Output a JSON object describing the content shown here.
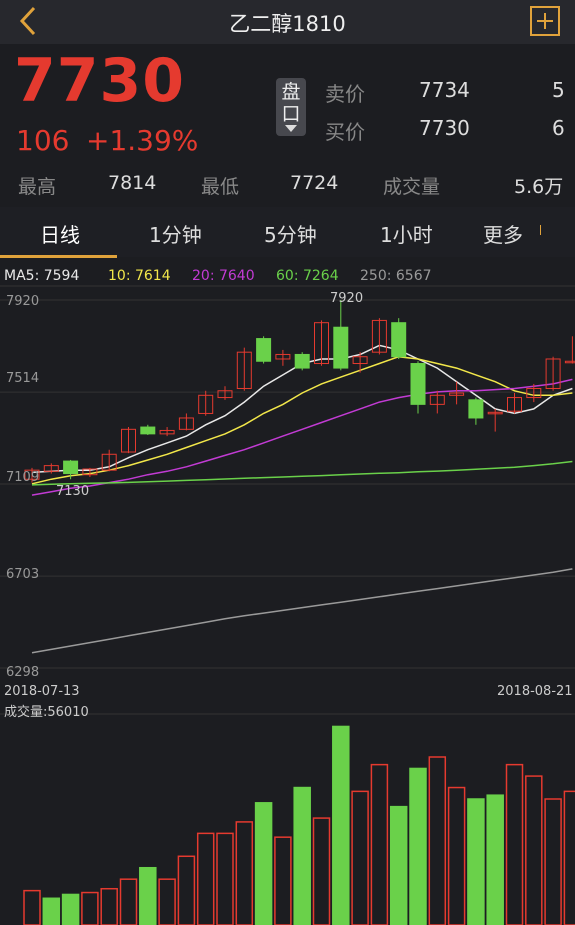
{
  "header": {
    "title": "乙二醇1810"
  },
  "quote": {
    "price": "7730",
    "change": "106",
    "change_pct": "+1.39%"
  },
  "panel_button": {
    "label": "盘口"
  },
  "orderbook": {
    "sell_label": "卖价",
    "sell_price": "7734",
    "sell_vol": "5",
    "buy_label": "买价",
    "buy_price": "7730",
    "buy_vol": "6"
  },
  "stats": {
    "high_label": "最高",
    "high": "7814",
    "low_label": "最低",
    "low": "7724",
    "vol_label": "成交量",
    "vol": "5.6万"
  },
  "tabs": [
    "日线",
    "1分钟",
    "5分钟",
    "1小时",
    "更多"
  ],
  "ma_legend": [
    {
      "text": "MA5: 7594",
      "color": "#e8e8e8"
    },
    {
      "text": "10: 7614",
      "color": "#f2e74a"
    },
    {
      "text": "20: 7640",
      "color": "#c23bd4"
    },
    {
      "text": "60: 7264",
      "color": "#6ad14a"
    },
    {
      "text": "250: 6567",
      "color": "#9a9a9a"
    }
  ],
  "chart_data": [
    {
      "type": "candlestick",
      "y_ticks": [
        "7920",
        "7514",
        "7109",
        "6703",
        "6298"
      ],
      "x_tick_start": "2018-07-13",
      "x_tick_end": "2018-08-21",
      "ylim": [
        6298,
        7920
      ],
      "annotations": [
        {
          "text": "7920",
          "value": 7920
        },
        {
          "text": "7130",
          "value": 7130
        }
      ],
      "candles": [
        {
          "o": 7130,
          "c": 7170,
          "h": 7180,
          "l": 7115
        },
        {
          "o": 7165,
          "c": 7190,
          "h": 7200,
          "l": 7155
        },
        {
          "o": 7210,
          "c": 7155,
          "h": 7215,
          "l": 7130
        },
        {
          "o": 7150,
          "c": 7175,
          "h": 7180,
          "l": 7140
        },
        {
          "o": 7170,
          "c": 7240,
          "h": 7260,
          "l": 7165
        },
        {
          "o": 7250,
          "c": 7350,
          "h": 7360,
          "l": 7245
        },
        {
          "o": 7360,
          "c": 7330,
          "h": 7370,
          "l": 7325
        },
        {
          "o": 7330,
          "c": 7345,
          "h": 7360,
          "l": 7320
        },
        {
          "o": 7350,
          "c": 7400,
          "h": 7420,
          "l": 7345
        },
        {
          "o": 7420,
          "c": 7500,
          "h": 7520,
          "l": 7410
        },
        {
          "o": 7490,
          "c": 7520,
          "h": 7540,
          "l": 7480
        },
        {
          "o": 7530,
          "c": 7690,
          "h": 7710,
          "l": 7520
        },
        {
          "o": 7750,
          "c": 7650,
          "h": 7760,
          "l": 7640
        },
        {
          "o": 7660,
          "c": 7680,
          "h": 7700,
          "l": 7630
        },
        {
          "o": 7680,
          "c": 7620,
          "h": 7690,
          "l": 7610
        },
        {
          "o": 7640,
          "c": 7820,
          "h": 7830,
          "l": 7630
        },
        {
          "o": 7800,
          "c": 7620,
          "h": 7920,
          "l": 7610
        },
        {
          "o": 7640,
          "c": 7670,
          "h": 7690,
          "l": 7600
        },
        {
          "o": 7690,
          "c": 7830,
          "h": 7840,
          "l": 7680
        },
        {
          "o": 7820,
          "c": 7670,
          "h": 7840,
          "l": 7660
        },
        {
          "o": 7640,
          "c": 7460,
          "h": 7650,
          "l": 7420
        },
        {
          "o": 7460,
          "c": 7500,
          "h": 7520,
          "l": 7420
        },
        {
          "o": 7500,
          "c": 7510,
          "h": 7560,
          "l": 7460
        },
        {
          "o": 7480,
          "c": 7400,
          "h": 7490,
          "l": 7370
        },
        {
          "o": 7420,
          "c": 7425,
          "h": 7440,
          "l": 7340
        },
        {
          "o": 7430,
          "c": 7490,
          "h": 7510,
          "l": 7420
        },
        {
          "o": 7490,
          "c": 7530,
          "h": 7550,
          "l": 7470
        },
        {
          "o": 7530,
          "c": 7660,
          "h": 7670,
          "l": 7520
        },
        {
          "o": 7650,
          "c": 7650,
          "h": 7760,
          "l": 7640
        }
      ],
      "ma_lines": [
        {
          "name": "MA5",
          "color": "#e8e8e8",
          "values": [
            7160,
            7165,
            7170,
            7170,
            7185,
            7225,
            7260,
            7290,
            7320,
            7370,
            7410,
            7470,
            7540,
            7590,
            7640,
            7660,
            7660,
            7680,
            7720,
            7700,
            7660,
            7620,
            7560,
            7500,
            7440,
            7420,
            7440,
            7500,
            7530
          ]
        },
        {
          "name": "MA10",
          "color": "#f2e74a",
          "values": [
            7110,
            7130,
            7145,
            7155,
            7170,
            7190,
            7215,
            7240,
            7270,
            7300,
            7330,
            7370,
            7420,
            7460,
            7510,
            7550,
            7580,
            7610,
            7640,
            7670,
            7660,
            7640,
            7620,
            7590,
            7560,
            7520,
            7500,
            7500,
            7510
          ]
        },
        {
          "name": "MA20",
          "color": "#c23bd4",
          "values": [
            7060,
            7075,
            7090,
            7100,
            7115,
            7130,
            7150,
            7165,
            7185,
            7210,
            7235,
            7260,
            7290,
            7320,
            7350,
            7380,
            7410,
            7440,
            7470,
            7490,
            7505,
            7515,
            7520,
            7520,
            7525,
            7530,
            7540,
            7550,
            7570
          ]
        },
        {
          "name": "MA60",
          "color": "#6ad14a",
          "values": [
            7105,
            7108,
            7110,
            7112,
            7114,
            7116,
            7119,
            7122,
            7125,
            7128,
            7131,
            7134,
            7137,
            7140,
            7143,
            7146,
            7150,
            7153,
            7156,
            7159,
            7163,
            7166,
            7170,
            7174,
            7178,
            7183,
            7190,
            7198,
            7208
          ]
        },
        {
          "name": "MA250",
          "color": "#9a9a9a",
          "values": [
            6365,
            6380,
            6395,
            6410,
            6425,
            6440,
            6455,
            6470,
            6485,
            6500,
            6515,
            6528,
            6540,
            6552,
            6564,
            6576,
            6588,
            6600,
            6612,
            6624,
            6636,
            6648,
            6660,
            6672,
            6684,
            6696,
            6708,
            6720,
            6735
          ]
        }
      ]
    },
    {
      "type": "bar",
      "title": "成交量:56010",
      "values": [
        18000,
        14000,
        16000,
        17000,
        19000,
        24000,
        30000,
        24000,
        36000,
        48000,
        48000,
        54000,
        64000,
        46000,
        72000,
        56000,
        104000,
        70000,
        84000,
        62000,
        82000,
        88000,
        72000,
        66000,
        68000,
        84000,
        78000,
        66000,
        70000,
        42000
      ],
      "colors": [
        "#e53a2f",
        "#6ad14a",
        "#6ad14a",
        "#e53a2f",
        "#e53a2f",
        "#e53a2f",
        "#6ad14a",
        "#e53a2f",
        "#e53a2f",
        "#e53a2f",
        "#e53a2f",
        "#e53a2f",
        "#6ad14a",
        "#e53a2f",
        "#6ad14a",
        "#e53a2f",
        "#6ad14a",
        "#e53a2f",
        "#e53a2f",
        "#6ad14a",
        "#6ad14a",
        "#e53a2f",
        "#e53a2f",
        "#6ad14a",
        "#6ad14a",
        "#e53a2f",
        "#e53a2f",
        "#e53a2f",
        "#e53a2f",
        "#e53a2f"
      ]
    }
  ]
}
